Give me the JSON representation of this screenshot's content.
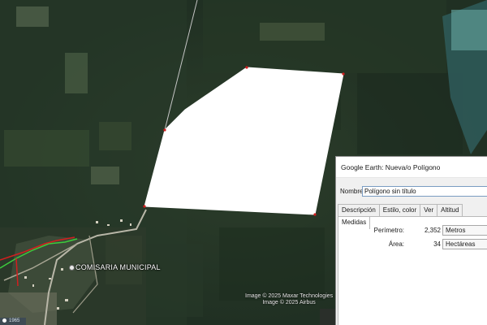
{
  "map": {
    "place_label": "COMISARIA MUNICIPAL",
    "imagery_credits": [
      "Image © 2025 Maxar Technologies",
      "Image © 2025 Airbus"
    ],
    "scale_tag": "1965",
    "polygon_fill": "#ffffff",
    "vertex_color": "#d01e1e",
    "path_colors": {
      "red": "#d21f1f",
      "green": "#3ccb3c"
    }
  },
  "dialog": {
    "title": "Google Earth: Nueva/o Polígono",
    "name_label": "Nombre:",
    "name_value": "Polígono sin título",
    "tabs": [
      {
        "label": "Descripción",
        "active": false
      },
      {
        "label": "Estilo, color",
        "active": false
      },
      {
        "label": "Ver",
        "active": false
      },
      {
        "label": "Altitud",
        "active": false
      },
      {
        "label": "Medidas",
        "active": true
      }
    ],
    "measures": {
      "perimeter_label": "Perímetro:",
      "perimeter_value": "2,352",
      "perimeter_unit": "Metros",
      "area_label": "Área:",
      "area_value": "34",
      "area_unit": "Hectáreas"
    }
  }
}
